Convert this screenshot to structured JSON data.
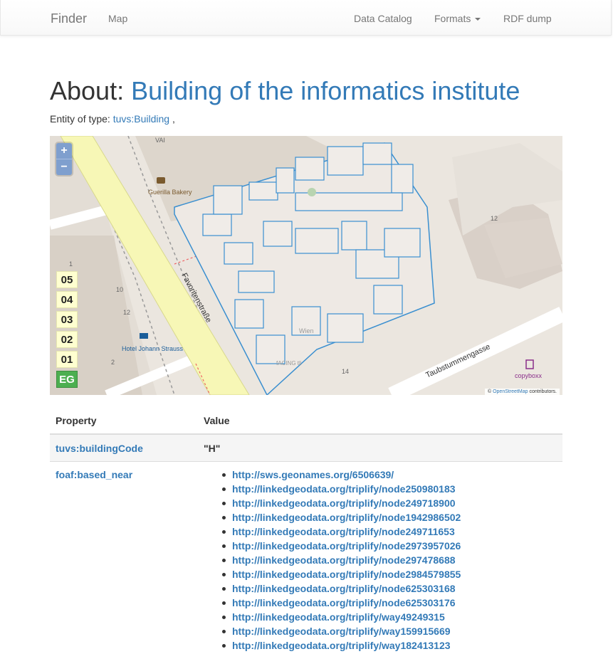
{
  "nav": {
    "brand": "Finder",
    "map": "Map",
    "catalog": "Data Catalog",
    "formats": "Formats",
    "rdf": "RDF dump"
  },
  "heading": {
    "prefix": "About:",
    "title": "Building of the informatics institute"
  },
  "entity": {
    "label": "Entity of type:",
    "type_link": "tuvs:Building",
    "suffix": ","
  },
  "map": {
    "zoom_in": "+",
    "zoom_out": "−",
    "levels": [
      "05",
      "04",
      "03",
      "02",
      "01",
      "EG"
    ],
    "active_level": "EG",
    "street_labels": [
      "Favoritenstraße",
      "Taubstummengasse"
    ],
    "poi_labels": [
      "Guerilla Bakery",
      "Hotel Johann Strauss",
      "copyboxx",
      "VAI",
      "Wien",
      "fACING tli"
    ],
    "house_numbers": [
      "12",
      "10",
      "12",
      "1",
      "2",
      "14"
    ],
    "attribution_prefix": "©",
    "attribution_link": "OpenStreetMap",
    "attribution_suffix": "contributors."
  },
  "table": {
    "headers": [
      "Property",
      "Value"
    ],
    "rows": [
      {
        "property": "tuvs:buildingCode",
        "value": "\"H\""
      },
      {
        "property": "foaf:based_near",
        "values": [
          "http://sws.geonames.org/6506639/",
          "http://linkedgeodata.org/triplify/node250980183",
          "http://linkedgeodata.org/triplify/node249718900",
          "http://linkedgeodata.org/triplify/node1942986502",
          "http://linkedgeodata.org/triplify/node249711653",
          "http://linkedgeodata.org/triplify/node2973957026",
          "http://linkedgeodata.org/triplify/node297478688",
          "http://linkedgeodata.org/triplify/node2984579855",
          "http://linkedgeodata.org/triplify/node625303168",
          "http://linkedgeodata.org/triplify/node625303176",
          "http://linkedgeodata.org/triplify/way49249315",
          "http://linkedgeodata.org/triplify/way159915669",
          "http://linkedgeodata.org/triplify/way182413123"
        ]
      }
    ]
  },
  "colors": {
    "link": "#337ab7",
    "outline": "#3a8fd0",
    "street": "#f7f7b6",
    "active_level": "#4caf50"
  }
}
